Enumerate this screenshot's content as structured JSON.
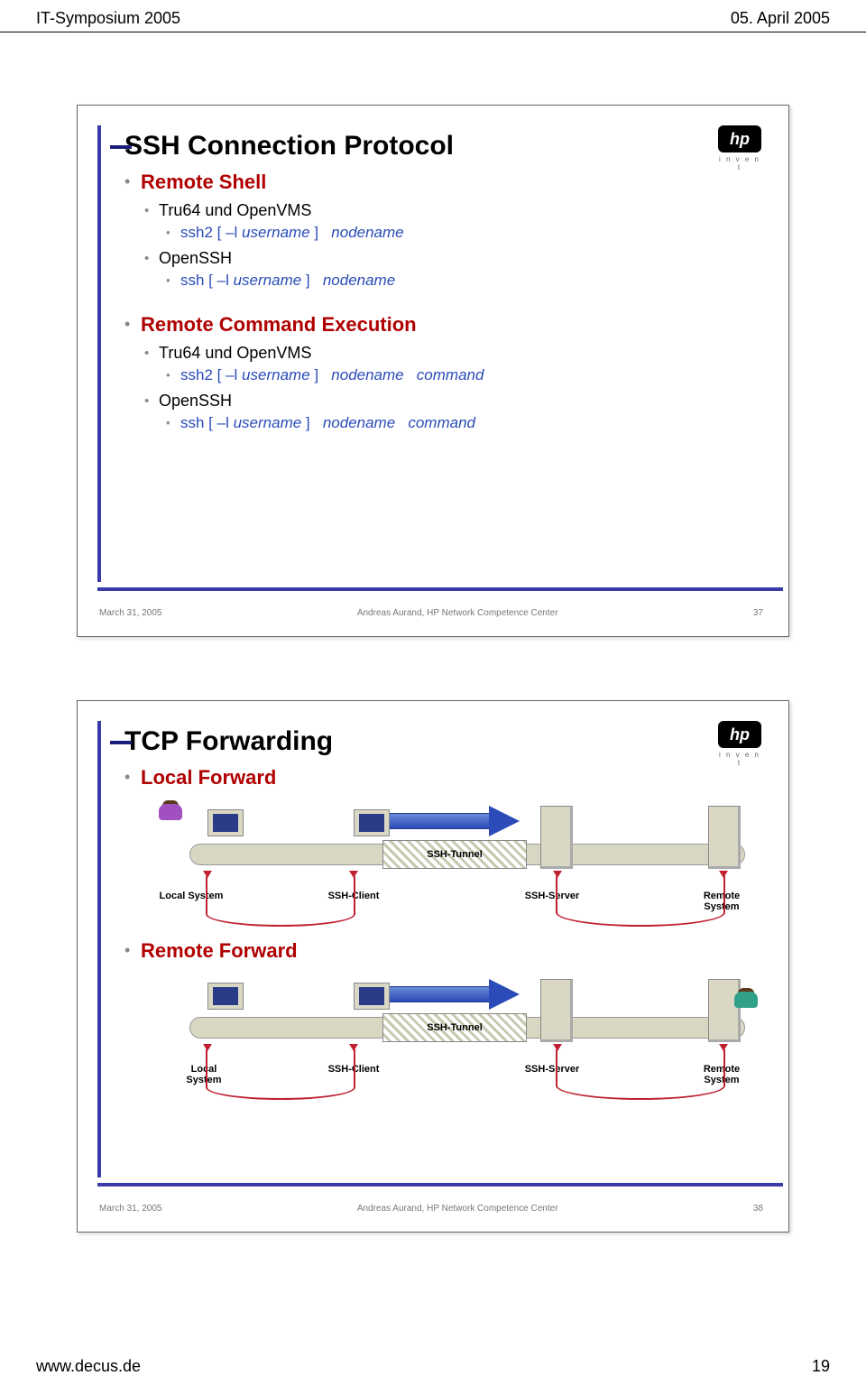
{
  "header": {
    "left": "IT-Symposium 2005",
    "right": "05. April 2005"
  },
  "footer": {
    "left": "www.decus.de",
    "right": "19"
  },
  "hp_tag": "i n v e n t",
  "slide1": {
    "title": "SSH Connection Protocol",
    "sec1": "Remote Shell",
    "sec1_a": "Tru64 und OpenVMS",
    "sec1_a1": "ssh2 [ –l username ]   nodename",
    "sec1_b": "OpenSSH",
    "sec1_b1": "ssh [ –l username ]   nodename",
    "sec2": "Remote Command Execution",
    "sec2_a": "Tru64 und OpenVMS",
    "sec2_a1": "ssh2 [ –l username ]   nodename   command",
    "sec2_b": "OpenSSH",
    "sec2_b1": "ssh [ –l username ]   nodename   command",
    "foot_date": "March 31, 2005",
    "foot_auth": "Andreas Aurand, HP Network Competence Center",
    "foot_num": "37"
  },
  "slide2": {
    "title": "TCP Forwarding",
    "sec1": "Local Forward",
    "sec2": "Remote Forward",
    "labels": {
      "local_system": "Local System",
      "ssh_client": "SSH-Client",
      "ssh_server": "SSH-Server",
      "remote_system": "Remote\nSystem",
      "local_system_2l": "Local\nSystem",
      "tunnel": "SSH‑Tunnel"
    },
    "foot_date": "March 31, 2005",
    "foot_auth": "Andreas Aurand, HP Network Competence Center",
    "foot_num": "38"
  }
}
